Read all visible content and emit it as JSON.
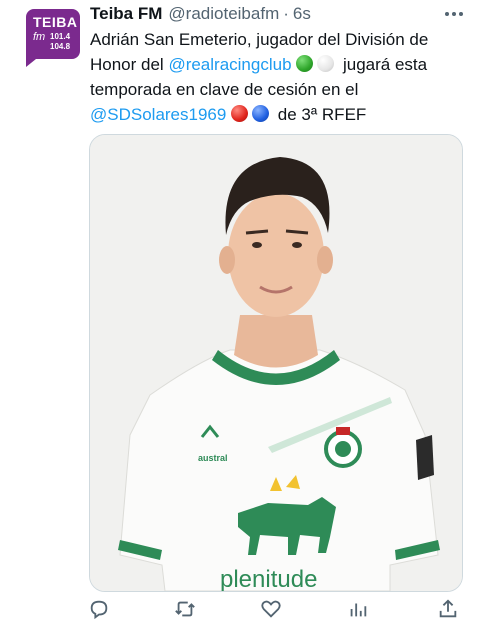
{
  "tweet": {
    "author_name": "Teiba FM",
    "handle": "@radioteibafm",
    "separator": "·",
    "time": "6s",
    "text_part1": "Adrián San Emeterio, jugador del División de Honor del ",
    "mention1": "@realracingclub",
    "text_part2": " jugará esta temporada en clave de cesión en el ",
    "mention2": "@SDSolares1969",
    "text_part3": " de 3ª RFEF"
  },
  "avatar": {
    "brand": "TEIBA",
    "fm": "fm",
    "freq1": "101.4",
    "freq2": "104.8"
  },
  "photo": {
    "sponsor_text": "plenitude",
    "kit_brand_text": "austral"
  },
  "actions": [
    "reply-icon",
    "retweet-icon",
    "like-icon",
    "views-icon",
    "share-icon"
  ],
  "colors": {
    "link": "#1d9bf0",
    "secondary_text": "#536471",
    "avatar_bg": "#7b2a8e",
    "jersey_green": "#2e8b57"
  }
}
